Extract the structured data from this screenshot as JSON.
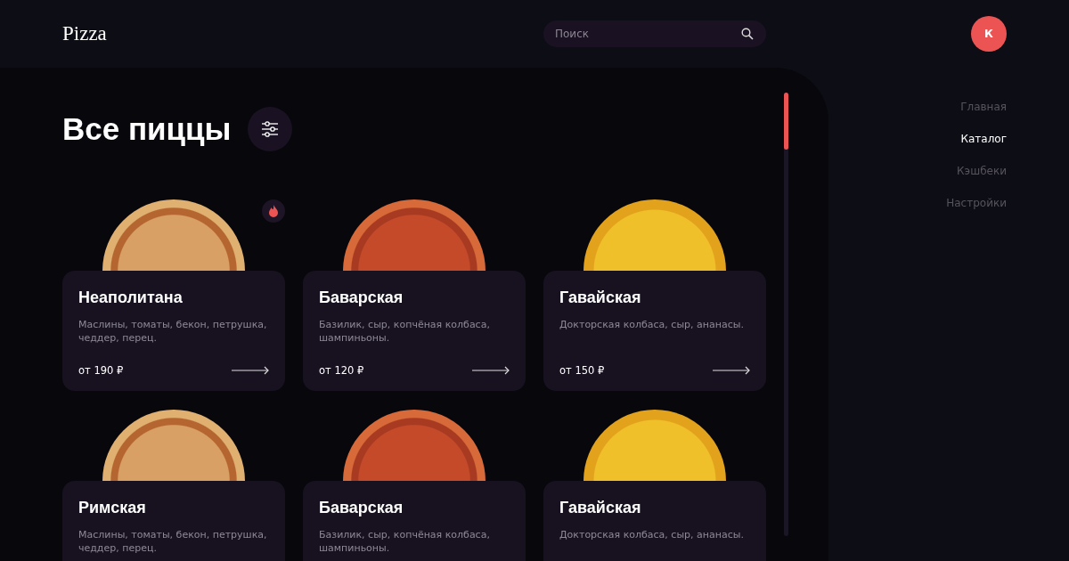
{
  "header": {
    "logo": "Pizza",
    "search": {
      "placeholder": "Поиск"
    },
    "avatar": "К"
  },
  "page": {
    "title": "Все пиццы"
  },
  "pizzas": [
    {
      "name": "Неаполитана",
      "description": "Маслины, томаты, бекон, петрушка, чеддер, перец.",
      "price": "от 190 ₽",
      "kind": "pepperoni",
      "hot": true
    },
    {
      "name": "Баварская",
      "description": "Базилик, сыр, копчёная колбаса, шампиньоны.",
      "price": "от 120 ₽",
      "kind": "salami",
      "hot": false
    },
    {
      "name": "Гавайская",
      "description": "Докторская колбаса, сыр, ананасы.",
      "price": "от 150 ₽",
      "kind": "hawaiian",
      "hot": false
    },
    {
      "name": "Римская",
      "description": "Маслины, томаты, бекон, петрушка, чеддер, перец.",
      "kind": "pepperoni",
      "hot": false
    },
    {
      "name": "Баварская",
      "description": "Базилик, сыр, копчёная колбаса, шампиньоны.",
      "kind": "salami",
      "hot": false
    },
    {
      "name": "Гавайская",
      "description": "Докторская колбаса, сыр, ананасы.",
      "kind": "hawaiian",
      "hot": false
    }
  ],
  "nav": [
    {
      "label": "Главная",
      "selected": false
    },
    {
      "label": "Каталог",
      "selected": true
    },
    {
      "label": "Кэшбеки",
      "selected": false
    },
    {
      "label": "Настройки",
      "selected": false
    }
  ]
}
